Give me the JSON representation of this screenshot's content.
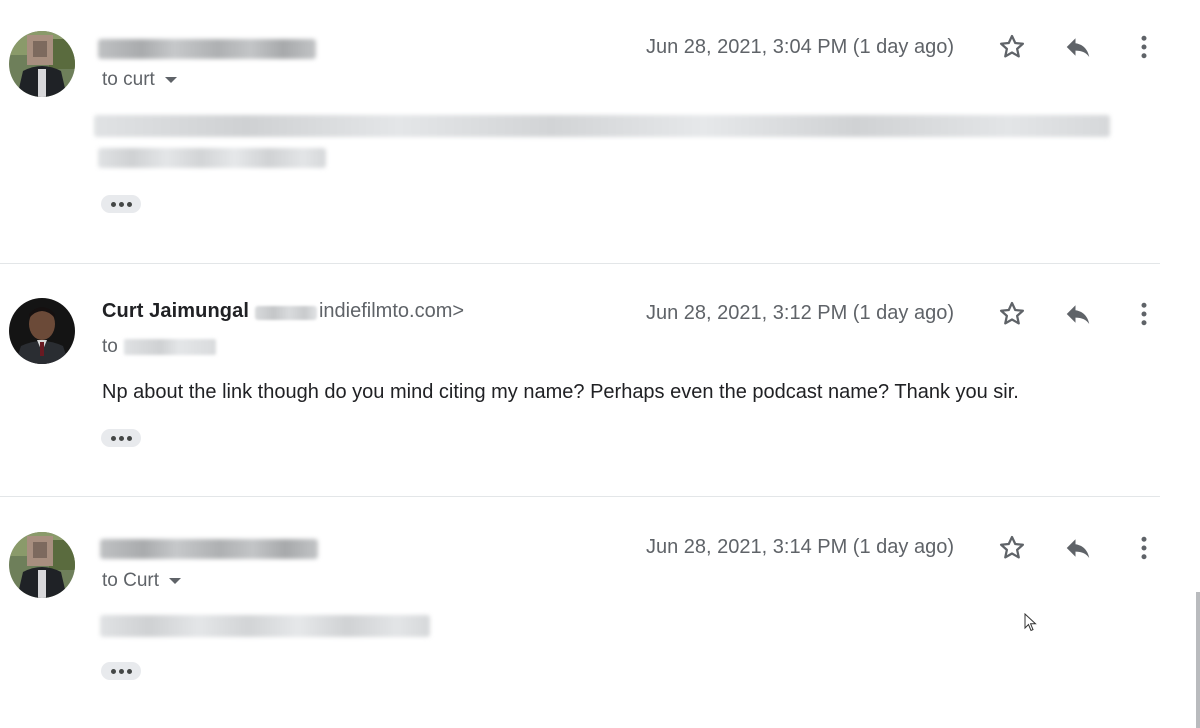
{
  "messages": [
    {
      "recipient_text": "to curt",
      "date": "Jun 28, 2021, 3:04 PM (1 day ago)"
    },
    {
      "sender_name": "Curt Jaimungal",
      "sender_email_visible": "indiefilmto.com>",
      "recipient_text": "to",
      "date": "Jun 28, 2021, 3:12 PM (1 day ago)",
      "body": "Np about the link though do you mind citing my name? Perhaps even the podcast name? Thank you sir."
    },
    {
      "recipient_text": "to Curt",
      "date": "Jun 28, 2021, 3:14 PM (1 day ago)"
    }
  ],
  "icons": {
    "star": "star-outline-icon",
    "reply": "reply-icon",
    "more": "more-vertical-icon",
    "expand": "ellipsis-icon",
    "recipient_dropdown": "caret-down-icon"
  },
  "colors": {
    "text_primary": "#202124",
    "text_secondary": "#5f6368",
    "divider": "#e3e6e8",
    "chip": "#e8eaed"
  }
}
